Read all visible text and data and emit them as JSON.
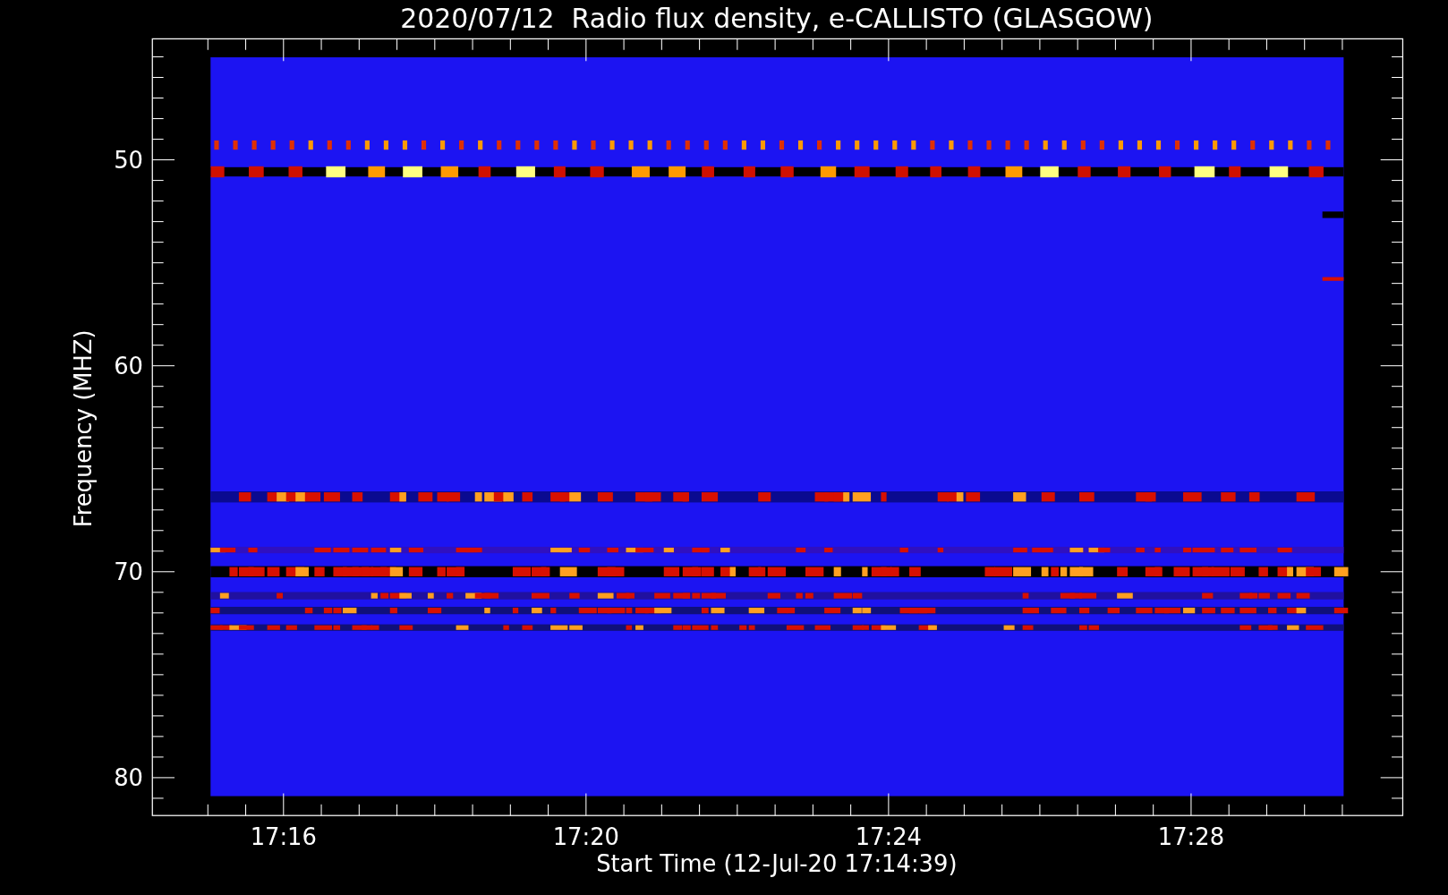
{
  "title": "2020/07/12  Radio flux density, e-CALLISTO (GLASGOW)",
  "plot": {
    "ylabel": "Frequency (MHZ)",
    "xlabel": "Start Time (12-Jul-20 17:14:39)",
    "yticks": [
      "50",
      "60",
      "70",
      "80"
    ],
    "xticks": [
      "17:16",
      "17:20",
      "17:24",
      "17:28"
    ]
  }
}
